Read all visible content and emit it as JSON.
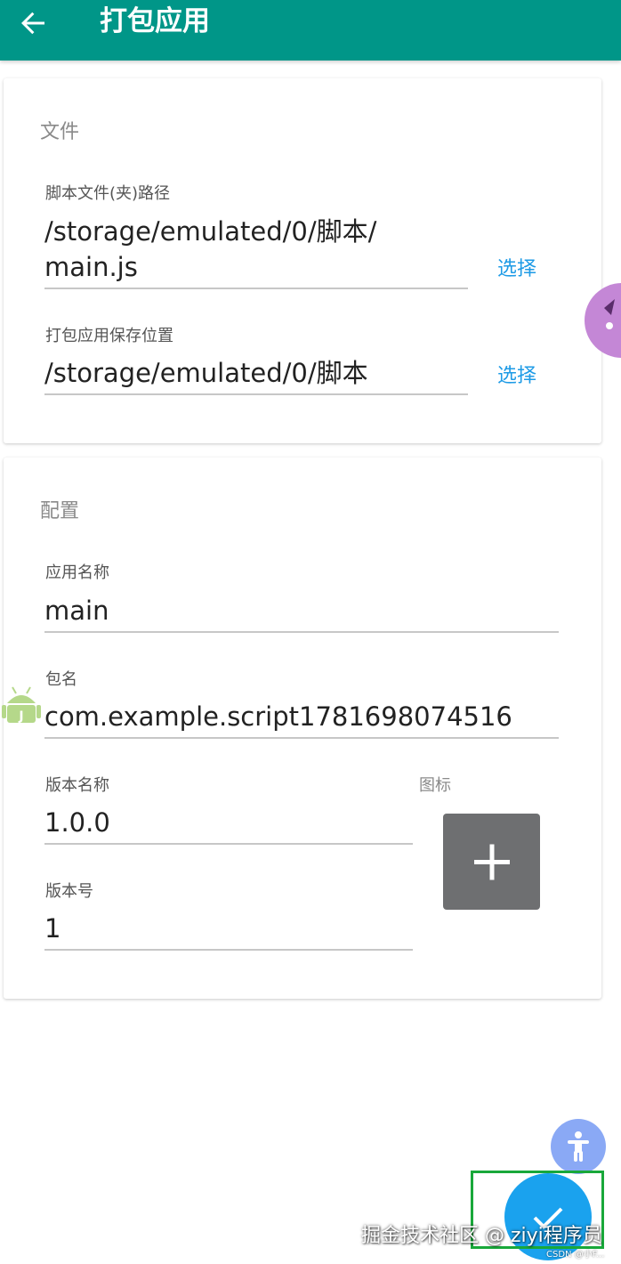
{
  "appbar": {
    "title": "打包应用",
    "back_icon": "arrow-left-icon"
  },
  "files_section": {
    "title": "文件",
    "script_path": {
      "label": "脚本文件(夹)路径",
      "value": "/storage/emulated/0/脚本/\nmain.js",
      "action": "选择"
    },
    "save_location": {
      "label": "打包应用保存位置",
      "value": "/storage/emulated/0/脚本",
      "action": "选择"
    }
  },
  "config_section": {
    "title": "配置",
    "app_name": {
      "label": "应用名称",
      "value": "main"
    },
    "package_name": {
      "label": "包名",
      "value": "com.example.script1781698074516"
    },
    "version_name": {
      "label": "版本名称",
      "value": "1.0.0"
    },
    "version_code": {
      "label": "版本号",
      "value": "1"
    },
    "icon": {
      "label": "图标",
      "add_icon": "plus-icon"
    }
  },
  "fab": {
    "icon": "check-icon"
  },
  "floating": {
    "accessibility_icon": "accessibility-icon",
    "android_icon": "android-icon"
  },
  "watermark": {
    "main": "掘金技术社区 @ ziyi程序员",
    "small": "CSDN @小F..."
  },
  "colors": {
    "appbar": "#009688",
    "link": "#1e9be6",
    "fab": "#1aa2ee",
    "icon_button": "#6e6f71",
    "highlight": "#19a83a"
  }
}
